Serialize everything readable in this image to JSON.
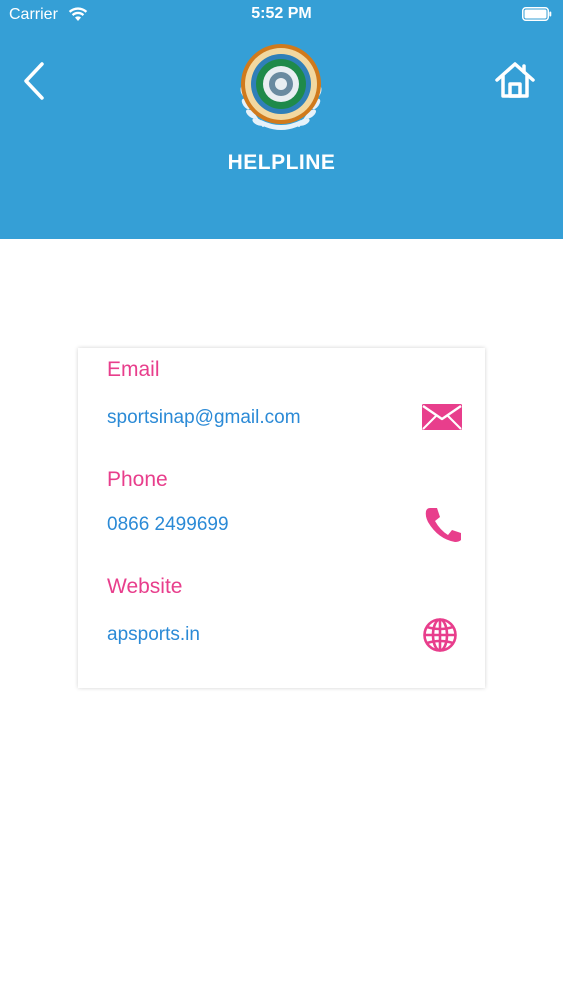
{
  "status_bar": {
    "carrier": "Carrier",
    "time": "5:52 PM"
  },
  "header": {
    "title": "HELPLINE",
    "back_icon": "chevron-left-icon",
    "home_icon": "home-icon",
    "logo": "sports-authority-andhra-pradesh-emblem",
    "background_color": "#359fd6"
  },
  "contact": {
    "email": {
      "label": "Email",
      "value": "sportsinap@gmail.com",
      "icon": "envelope-icon"
    },
    "phone": {
      "label": "Phone",
      "value": "0866 2499699",
      "icon": "phone-icon"
    },
    "website": {
      "label": "Website",
      "value": "apsports.in",
      "icon": "globe-icon"
    },
    "label_color": "#e83e8c",
    "value_color": "#2b8ad6"
  }
}
